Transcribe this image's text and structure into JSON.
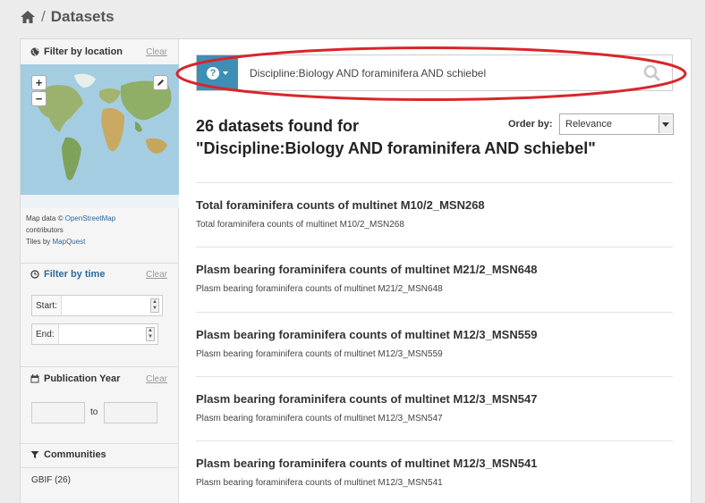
{
  "breadcrumb": {
    "home_icon": "home-icon",
    "separator": "/",
    "current": "Datasets"
  },
  "sidebar": {
    "location": {
      "title": "Filter by location",
      "clear": "Clear",
      "icon": "globe-icon",
      "attribution": {
        "prefix": "Map data ©",
        "osm_link": "OpenStreetMap",
        "contributors": "contributors",
        "tiles": "Tiles by",
        "tiles_link": "MapQuest"
      }
    },
    "time": {
      "title": "Filter by time",
      "clear": "Clear",
      "icon": "clock-icon",
      "start_label": "Start:",
      "end_label": "End:",
      "start_value": "",
      "end_value": ""
    },
    "year": {
      "title": "Publication Year",
      "clear": "Clear",
      "icon": "calendar-icon",
      "to_label": "to",
      "from_value": "",
      "to_value": ""
    },
    "communities": {
      "title": "Communities",
      "icon": "filter-icon",
      "items": [
        {
          "label": "GBIF (26)"
        }
      ]
    }
  },
  "search": {
    "query": "Discipline:Biology AND foraminifera AND schiebel",
    "accent": "#3e8fb5",
    "annotation_color": "#d9252b"
  },
  "results_header": {
    "line1": "26 datasets found for",
    "line2": "\"Discipline:Biology AND foraminifera AND schiebel\"",
    "order_label": "Order by:",
    "order_value": "Relevance"
  },
  "results": [
    {
      "title": "Total foraminifera counts of multinet M10/2_MSN268",
      "desc": "Total foraminifera counts of multinet M10/2_MSN268"
    },
    {
      "title": "Plasm bearing foraminifera counts of multinet M21/2_MSN648",
      "desc": "Plasm bearing foraminifera counts of multinet M21/2_MSN648"
    },
    {
      "title": "Plasm bearing foraminifera counts of multinet M12/3_MSN559",
      "desc": "Plasm bearing foraminifera counts of multinet M12/3_MSN559"
    },
    {
      "title": "Plasm bearing foraminifera counts of multinet M12/3_MSN547",
      "desc": "Plasm bearing foraminifera counts of multinet M12/3_MSN547"
    },
    {
      "title": "Plasm bearing foraminifera counts of multinet M12/3_MSN541",
      "desc": "Plasm bearing foraminifera counts of multinet M12/3_MSN541"
    }
  ]
}
